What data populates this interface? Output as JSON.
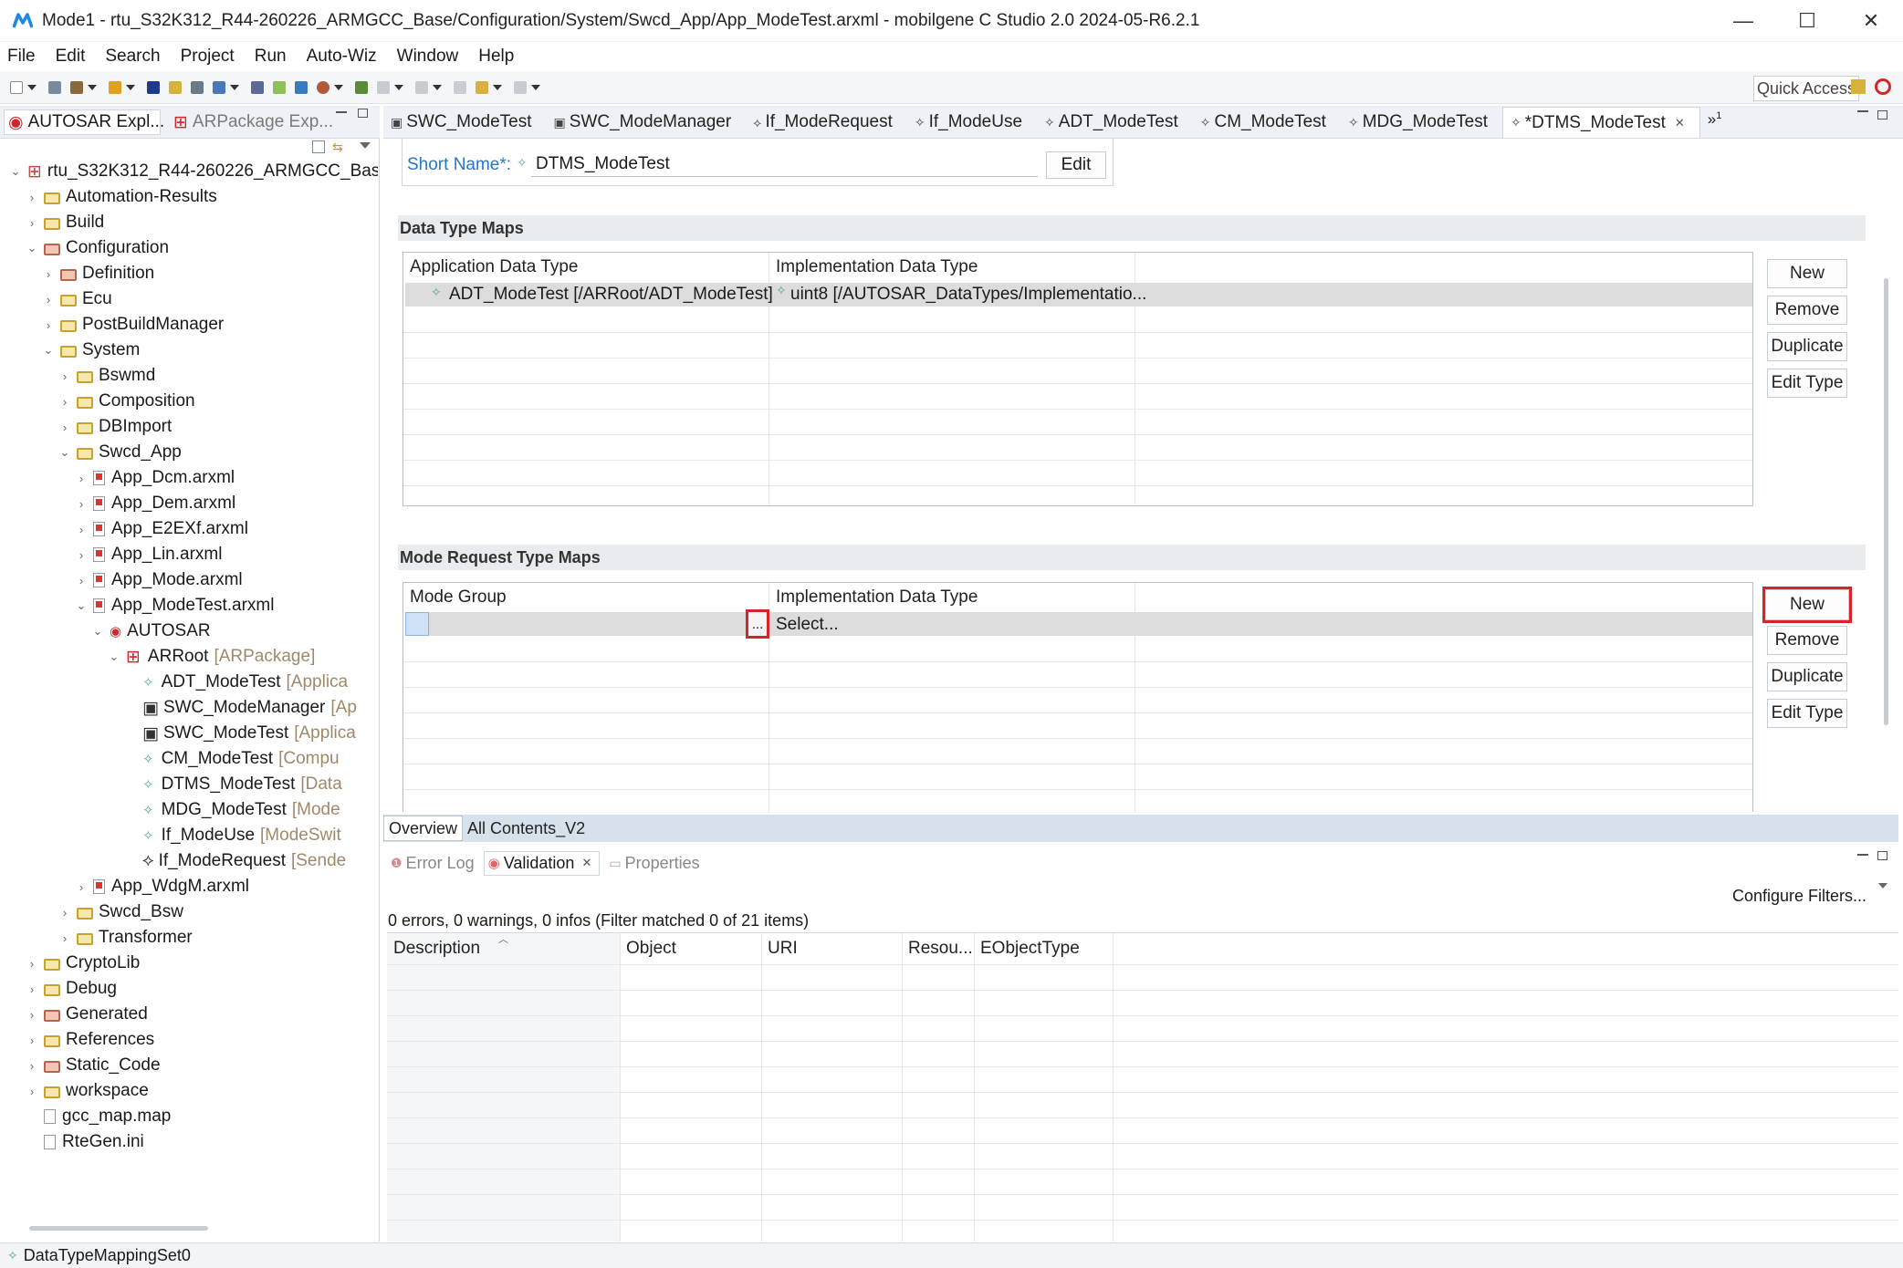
{
  "window": {
    "title": "Mode1 - rtu_S32K312_R44-260226_ARMGCC_Base/Configuration/System/Swcd_App/App_ModeTest.arxml - mobilgene C Studio 2.0 2024-05-R6.2.1",
    "minimize": "—",
    "maximize": "☐",
    "close": "✕"
  },
  "menu": [
    "File",
    "Edit",
    "Search",
    "Project",
    "Run",
    "Auto-Wiz",
    "Window",
    "Help"
  ],
  "quick_access": "Quick Access",
  "left_panel": {
    "tabs": [
      "AUTOSAR Expl...",
      "ARPackage Exp..."
    ],
    "tree": [
      {
        "label": "rtu_S32K312_R44-260226_ARMGCC_Base",
        "level": 0,
        "icon": "project",
        "expanded": true
      },
      {
        "label": "Automation-Results",
        "level": 1,
        "icon": "folder",
        "expanded": false
      },
      {
        "label": "Build",
        "level": 1,
        "icon": "folder",
        "expanded": false
      },
      {
        "label": "Configuration",
        "level": 1,
        "icon": "folder-red",
        "expanded": true
      },
      {
        "label": "Definition",
        "level": 2,
        "icon": "folder-red",
        "expanded": false
      },
      {
        "label": "Ecu",
        "level": 2,
        "icon": "folder",
        "expanded": false
      },
      {
        "label": "PostBuildManager",
        "level": 2,
        "icon": "folder",
        "expanded": false
      },
      {
        "label": "System",
        "level": 2,
        "icon": "folder",
        "expanded": true
      },
      {
        "label": "Bswmd",
        "level": 3,
        "icon": "folder",
        "expanded": false
      },
      {
        "label": "Composition",
        "level": 3,
        "icon": "folder",
        "expanded": false
      },
      {
        "label": "DBImport",
        "level": 3,
        "icon": "folder",
        "expanded": false
      },
      {
        "label": "Swcd_App",
        "level": 3,
        "icon": "folder",
        "expanded": true
      },
      {
        "label": "App_Dcm.arxml",
        "level": 4,
        "icon": "file",
        "expanded": false
      },
      {
        "label": "App_Dem.arxml",
        "level": 4,
        "icon": "file",
        "expanded": false
      },
      {
        "label": "App_E2EXf.arxml",
        "level": 4,
        "icon": "file",
        "expanded": false
      },
      {
        "label": "App_Lin.arxml",
        "level": 4,
        "icon": "file",
        "expanded": false
      },
      {
        "label": "App_Mode.arxml",
        "level": 4,
        "icon": "file",
        "expanded": false
      },
      {
        "label": "App_ModeTest.arxml",
        "level": 4,
        "icon": "file",
        "expanded": true
      },
      {
        "label": "AUTOSAR",
        "level": 5,
        "icon": "autosar",
        "expanded": true
      },
      {
        "label": "ARRoot",
        "suffix": "[ARPackage]",
        "level": 6,
        "icon": "package",
        "expanded": true
      },
      {
        "label": "ADT_ModeTest",
        "suffix": "[Applica",
        "level": 7,
        "icon": "diamond"
      },
      {
        "label": "SWC_ModeManager",
        "suffix": "[Ap",
        "level": 7,
        "icon": "component"
      },
      {
        "label": "SWC_ModeTest",
        "suffix": "[Applica",
        "level": 7,
        "icon": "component"
      },
      {
        "label": "CM_ModeTest",
        "suffix": "[Compu",
        "level": 7,
        "icon": "diamond"
      },
      {
        "label": "DTMS_ModeTest",
        "suffix": "[Data",
        "level": 7,
        "icon": "diamond"
      },
      {
        "label": "MDG_ModeTest",
        "suffix": "[Mode",
        "level": 7,
        "icon": "diamond"
      },
      {
        "label": "If_ModeUse",
        "suffix": "[ModeSwit",
        "level": 7,
        "icon": "diamond"
      },
      {
        "label": "If_ModeRequest",
        "suffix": "[Sende",
        "level": 7,
        "icon": "interface"
      },
      {
        "label": "App_WdgM.arxml",
        "level": 4,
        "icon": "file",
        "expanded": false
      },
      {
        "label": "Swcd_Bsw",
        "level": 3,
        "icon": "folder",
        "expanded": false
      },
      {
        "label": "Transformer",
        "level": 3,
        "icon": "folder",
        "expanded": false
      },
      {
        "label": "CryptoLib",
        "level": 1,
        "icon": "folder",
        "expanded": false
      },
      {
        "label": "Debug",
        "level": 1,
        "icon": "folder",
        "expanded": false
      },
      {
        "label": "Generated",
        "level": 1,
        "icon": "folder-red",
        "expanded": false
      },
      {
        "label": "References",
        "level": 1,
        "icon": "folder",
        "expanded": false
      },
      {
        "label": "Static_Code",
        "level": 1,
        "icon": "folder-red",
        "expanded": false
      },
      {
        "label": "workspace",
        "level": 1,
        "icon": "folder",
        "expanded": false
      },
      {
        "label": "gcc_map.map",
        "level": 1,
        "icon": "doc"
      },
      {
        "label": "RteGen.ini",
        "level": 1,
        "icon": "doc"
      }
    ]
  },
  "editor": {
    "tabs": [
      "SWC_ModeTest",
      "SWC_ModeManager",
      "If_ModeRequest",
      "If_ModeUse",
      "ADT_ModeTest",
      "CM_ModeTest",
      "MDG_ModeTest",
      "*DTMS_ModeTest"
    ],
    "overflow": "»",
    "overflow_count": "1",
    "short_name_label": "Short Name*:",
    "short_name_value": "DTMS_ModeTest",
    "edit_button": "Edit",
    "data_type_maps": {
      "title": "Data Type Maps",
      "columns": [
        "Application Data Type",
        "Implementation Data Type"
      ],
      "rows": [
        {
          "app": "ADT_ModeTest [/ARRoot/ADT_ModeTest]",
          "impl": "uint8 [/AUTOSAR_DataTypes/Implementatio..."
        }
      ],
      "buttons": [
        "New",
        "Remove",
        "Duplicate",
        "Edit Type"
      ]
    },
    "mode_request_type_maps": {
      "title": "Mode Request Type Maps",
      "columns": [
        "Mode Group",
        "Implementation Data Type"
      ],
      "browse": "...",
      "select": "Select...",
      "buttons": [
        "New",
        "Remove",
        "Duplicate",
        "Edit Type"
      ]
    },
    "page_tabs": [
      "Overview",
      "All Contents_V2"
    ]
  },
  "bottom": {
    "tabs": [
      "Error Log",
      "Validation",
      "Properties"
    ],
    "configure_filters": "Configure Filters...",
    "summary": "0 errors, 0 warnings, 0 infos (Filter matched 0 of 21 items)",
    "columns": [
      "Description",
      "Object",
      "URI",
      "Resou...",
      "EObjectType"
    ]
  },
  "status": "DataTypeMappingSet0"
}
